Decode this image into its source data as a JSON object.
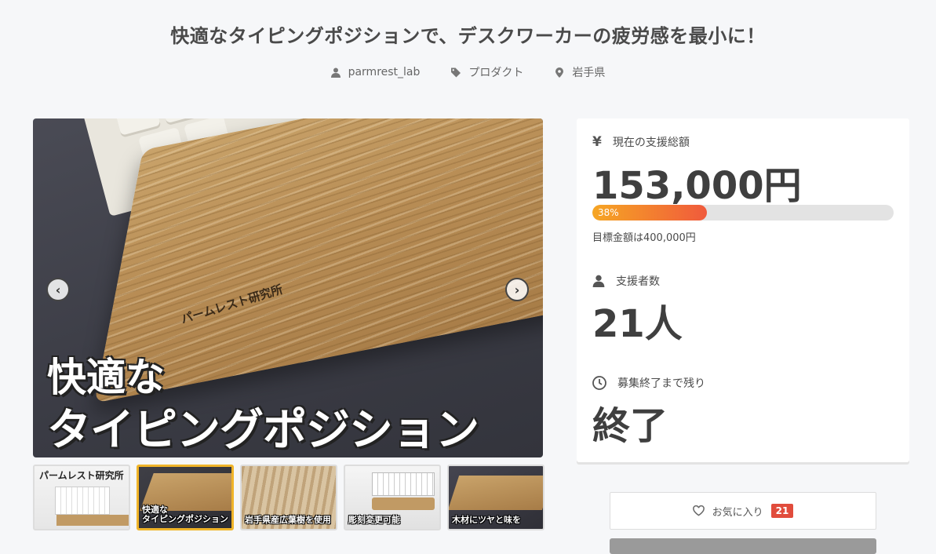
{
  "project": {
    "title": "快適なタイピングポジションで、デスクワーカーの疲労感を最小に！",
    "author": "parmrest_lab",
    "category": "プロダクト",
    "location": "岩手県"
  },
  "gallery": {
    "main_overlay_line1": "快適な",
    "main_overlay_line2": "タイピングポジション",
    "engraving": "パームレスト研究所",
    "prev_glyph": "‹",
    "next_glyph": "›",
    "thumbnails": [
      {
        "top": "パームレスト研究所",
        "label": ""
      },
      {
        "top": "",
        "label": "快適な\nタイピングポジション"
      },
      {
        "top": "",
        "label": "岩手県産広葉樹を使用"
      },
      {
        "top": "",
        "label": "彫刻変更可能"
      },
      {
        "top": "",
        "label": "木材にツヤと味を"
      }
    ]
  },
  "stats": {
    "currency_icon": "¥",
    "raised_label": "現在の支援総額",
    "raised_amount": "153,000円",
    "progress_percent": 38,
    "progress_text": "38%",
    "goal_text": "目標金額は400,000円",
    "supporters_label": "支援者数",
    "supporters_count": "21人",
    "time_label": "募集終了まで残り",
    "time_value": "終了"
  },
  "actions": {
    "favorite_label": "お気に入り",
    "favorite_count": "21"
  },
  "colors": {
    "progress_start": "#f6a623",
    "progress_end": "#f05a3c",
    "badge": "#e14c3c",
    "active_thumb_border": "#f0b429"
  }
}
